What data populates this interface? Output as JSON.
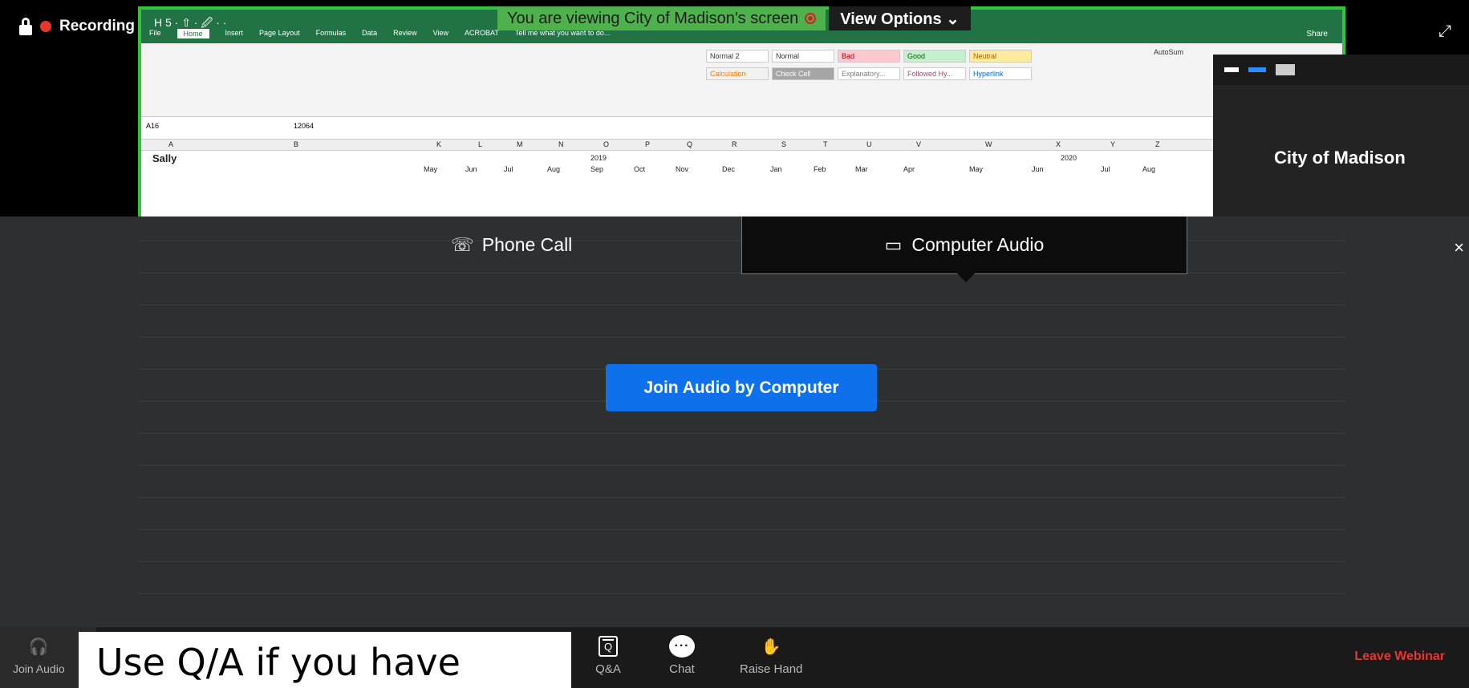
{
  "recording": {
    "label": "Recording"
  },
  "banner": {
    "viewing_text": "You are viewing City of Madison's screen",
    "view_options": "View Options"
  },
  "panel": {
    "name": "City of Madison"
  },
  "excel": {
    "quick_access": "H 5 · ⇧ · 🖉 · ·",
    "menus": [
      "File",
      "Home",
      "Insert",
      "Page Layout",
      "Formulas",
      "Data",
      "Review",
      "View",
      "ACROBAT",
      "Tell me what you want to do..."
    ],
    "share": "Share",
    "styles": [
      "Normal 2",
      "Normal",
      "Bad",
      "Good",
      "Neutral",
      "Calculation",
      "Check Cell",
      "Explanatory...",
      "Followed Hy...",
      "Hyperlink"
    ],
    "autosum": "AutoSum",
    "name_box": "A16",
    "formula": "12064",
    "columns": [
      "A",
      "B",
      "K",
      "L",
      "M",
      "N",
      "O",
      "P",
      "Q",
      "R",
      "S",
      "T",
      "U",
      "V",
      "W",
      "X",
      "Y",
      "Z"
    ],
    "year1": "2019",
    "year2": "2020",
    "months": [
      "May",
      "Jun",
      "Jul",
      "Aug",
      "Sep",
      "Oct",
      "Nov",
      "Dec",
      "Jan",
      "Feb",
      "Mar",
      "Apr",
      "May",
      "Jun",
      "Jul",
      "Aug"
    ],
    "cell_a1": "Sally"
  },
  "audio": {
    "tab_phone": "Phone Call",
    "tab_computer": "Computer Audio",
    "join_button": "Join Audio by Computer",
    "close": "×"
  },
  "toolbar": {
    "join_audio": "Join Audio",
    "qa": "Q&A",
    "qa_icon": "Q",
    "chat": "Chat",
    "chat_icon": "···",
    "raise_hand": "Raise Hand",
    "leave": "Leave Webinar"
  },
  "caption": {
    "text": "Use Q/A if you have"
  },
  "colors": {
    "zoom_blue": "#0e71eb",
    "excel_green": "#217346",
    "share_border": "#36c23a",
    "leave_red": "#e5372f"
  }
}
